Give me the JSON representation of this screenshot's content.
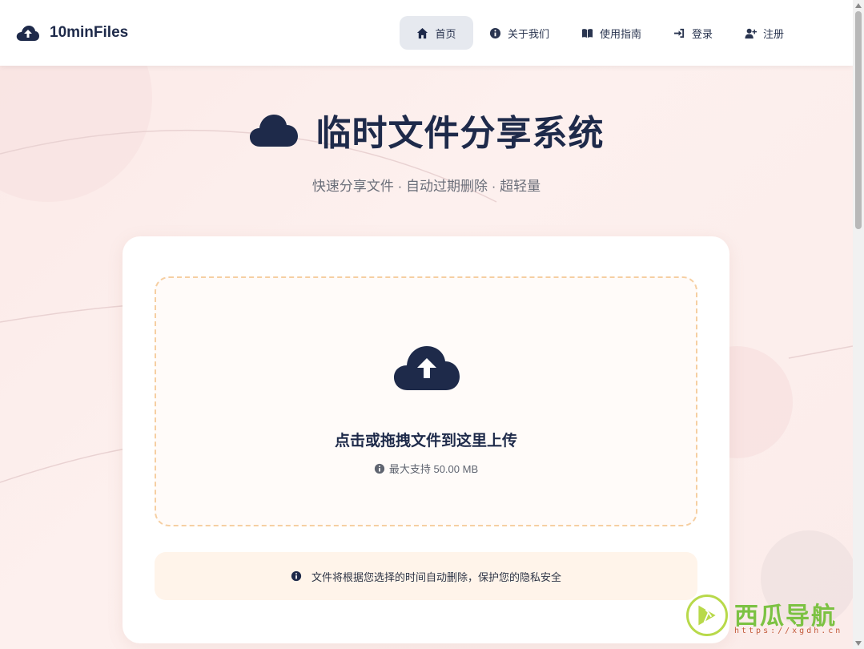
{
  "brand": {
    "name": "10minFiles",
    "icon": "cloud-upload-icon"
  },
  "nav": {
    "items": [
      {
        "label": "首页",
        "icon": "home-icon",
        "active": true
      },
      {
        "label": "关于我们",
        "icon": "info-circle-icon",
        "active": false
      },
      {
        "label": "使用指南",
        "icon": "book-icon",
        "active": false
      },
      {
        "label": "登录",
        "icon": "sign-in-icon",
        "active": false
      },
      {
        "label": "注册",
        "icon": "user-plus-icon",
        "active": false
      }
    ]
  },
  "hero": {
    "title": "临时文件分享系统",
    "icon": "cloud-icon",
    "subtitle": "快速分享文件 · 自动过期删除 · 超轻量"
  },
  "upload": {
    "icon": "cloud-upload-icon",
    "prompt": "点击或拖拽文件到这里上传",
    "limit_text": "最大支持 50.00 MB"
  },
  "notice": {
    "icon": "info-circle-icon",
    "text": "文件将根据您选择的时间自动删除，保护您的隐私安全"
  },
  "watermark": {
    "title": "西瓜导航",
    "url": "https://xgdh.cn"
  },
  "colors": {
    "primary": "#1e2a4a",
    "dropzone_border": "#f6cfa2",
    "background": "#fbeeee",
    "notice_bg": "#fff4ea"
  }
}
